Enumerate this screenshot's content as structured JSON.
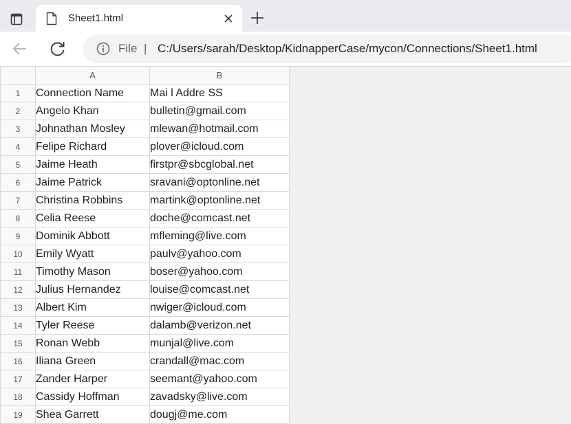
{
  "browser": {
    "tab": {
      "title": "Sheet1.html"
    },
    "address": {
      "scheme_label": "File",
      "separator": "|",
      "url": "C:/Users/sarah/Desktop/KidnapperCase/mycon/Connections/Sheet1.html"
    },
    "icons": [
      "tab-actions-icon",
      "file-icon",
      "close-icon",
      "plus-icon",
      "back-arrow-icon",
      "reload-icon",
      "info-icon"
    ]
  },
  "sheet": {
    "column_headers": [
      "A",
      "B"
    ],
    "rows": [
      {
        "num": "1",
        "a": "Connection Name",
        "b": "Mai l Addre SS"
      },
      {
        "num": "2",
        "a": "Angelo Khan",
        "b": "bulletin@gmail.com"
      },
      {
        "num": "3",
        "a": "Johnathan Mosley",
        "b": "mlewan@hotmail.com"
      },
      {
        "num": "4",
        "a": "Felipe Richard",
        "b": "plover@icloud.com"
      },
      {
        "num": "5",
        "a": "Jaime Heath",
        "b": "firstpr@sbcglobal.net"
      },
      {
        "num": "6",
        "a": "Jaime Patrick",
        "b": "sravani@optonline.net"
      },
      {
        "num": "7",
        "a": "Christina Robbins",
        "b": "martink@optonline.net"
      },
      {
        "num": "8",
        "a": "Celia Reese",
        "b": "doche@comcast.net"
      },
      {
        "num": "9",
        "a": "Dominik Abbott",
        "b": "mfleming@live.com"
      },
      {
        "num": "10",
        "a": "Emily Wyatt",
        "b": "paulv@yahoo.com"
      },
      {
        "num": "11",
        "a": "Timothy Mason",
        "b": "boser@yahoo.com"
      },
      {
        "num": "12",
        "a": "Julius Hernandez",
        "b": "louise@comcast.net"
      },
      {
        "num": "13",
        "a": "Albert Kim",
        "b": "nwiger@icloud.com"
      },
      {
        "num": "14",
        "a": "Tyler Reese",
        "b": "dalamb@verizon.net"
      },
      {
        "num": "15",
        "a": "Ronan Webb",
        "b": "munjal@live.com"
      },
      {
        "num": "16",
        "a": "Iliana Green",
        "b": "crandall@mac.com"
      },
      {
        "num": "17",
        "a": "Zander Harper",
        "b": "seemant@yahoo.com"
      },
      {
        "num": "18",
        "a": "Cassidy Hoffman",
        "b": "zavadsky@live.com"
      },
      {
        "num": "19",
        "a": "Shea Garrett",
        "b": "dougj@me.com"
      }
    ]
  }
}
